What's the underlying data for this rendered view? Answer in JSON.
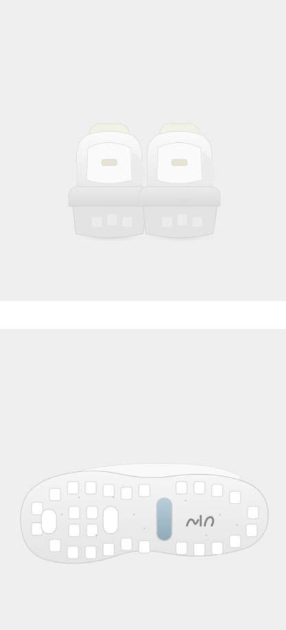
{
  "images": [
    {
      "name": "sneaker-pair-back-view",
      "background": "#efefef",
      "shoe_color": "#f7f7f7",
      "accent_color": "#e7e3d3"
    },
    {
      "name": "sneaker-outsole-view",
      "background": "#efefef",
      "sole_color": "#f4f4f4",
      "window_color": "#9fb9c8",
      "logo_text": "air"
    }
  ]
}
